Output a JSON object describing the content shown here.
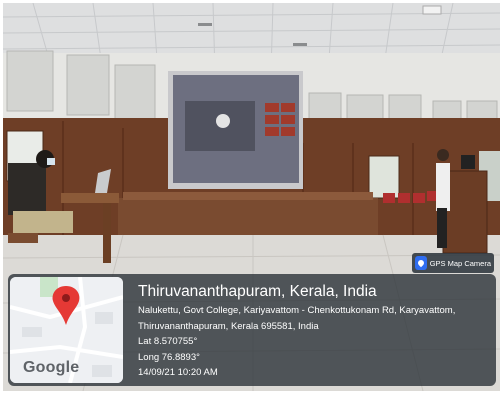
{
  "badge": {
    "label": "GPS Map Camera",
    "icon": "location-pin-icon"
  },
  "map": {
    "logo": "Google",
    "pin_color": "#e53935"
  },
  "location": {
    "title": "Thiruvananthapuram, Kerala, India",
    "address_line1": "Nalukettu, Govt College, Kariyavattom - Chenkottukonam Rd, Karyavattom,",
    "address_line2": "Thiruvananthapuram, Kerala 695581, India",
    "lat": "Lat 8.570755°",
    "long": "Long 76.8893°",
    "datetime": "14/09/21 10:20 AM"
  }
}
